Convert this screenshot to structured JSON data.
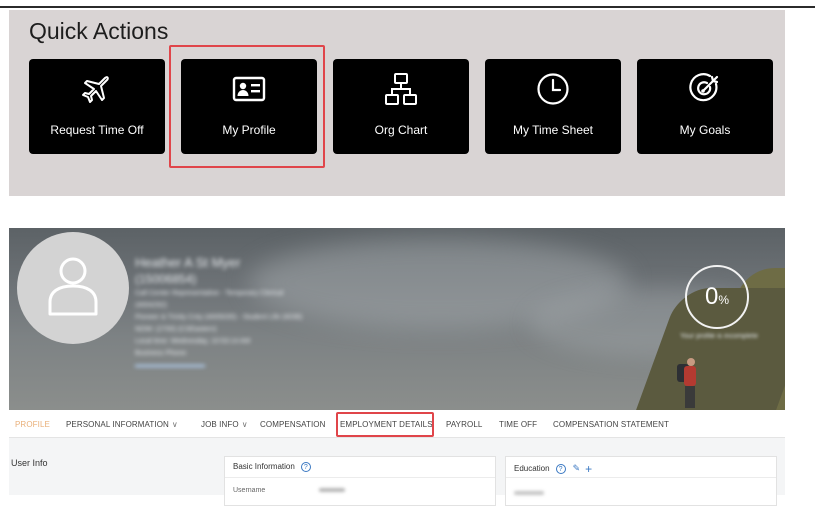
{
  "quick_actions": {
    "title": "Quick Actions",
    "tiles": [
      {
        "label": "Request Time Off",
        "icon": "airplane-icon"
      },
      {
        "label": "My Profile",
        "icon": "id-card-icon",
        "highlighted": true
      },
      {
        "label": "Org Chart",
        "icon": "org-chart-icon"
      },
      {
        "label": "My Time Sheet",
        "icon": "clock-icon"
      },
      {
        "label": "My Goals",
        "icon": "target-icon"
      }
    ],
    "highlight_color": "#e0454a"
  },
  "profile": {
    "employee_name": "Heather A St Myer",
    "employee_id": "(15006854)",
    "info_lines": [
      "Call Center Representative - Temporary Clerical",
      "(4004292)",
      "Pioneer & Trinity Cnty (4005035) - Student Life (4036)",
      "NOW: (2700) (CSEastern)",
      "Local time: Wednesday, 10:53:14 AM"
    ],
    "business_phone_label": "Business Phone:",
    "business_phone_value": "",
    "profile_completion": "0",
    "profile_completion_unit": "%",
    "profile_completion_note": "Your profile is incomplete"
  },
  "tabs": [
    {
      "label": "PROFILE",
      "active": true
    },
    {
      "label": "PERSONAL INFORMATION",
      "dropdown": true
    },
    {
      "label": "JOB INFO",
      "dropdown": true
    },
    {
      "label": "COMPENSATION"
    },
    {
      "label": "EMPLOYMENT DETAILS",
      "highlighted": true
    },
    {
      "label": "PAYROLL"
    },
    {
      "label": "TIME OFF"
    },
    {
      "label": "COMPENSATION STATEMENT"
    }
  ],
  "content": {
    "section_title": "User Info",
    "basic_info_title": "Basic Information",
    "username_label": "Username",
    "education_title": "Education"
  },
  "colors": {
    "tile_bg": "#000000",
    "panel_bg": "#d9d4d4",
    "active_tab": "#e9b07a",
    "link_blue": "#3a78c2"
  }
}
